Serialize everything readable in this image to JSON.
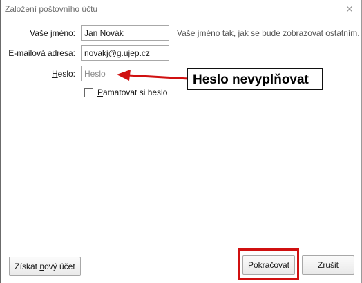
{
  "window": {
    "title": "Založení poštovního účtu",
    "close_glyph": "✕"
  },
  "form": {
    "name": {
      "label_pre": "",
      "label_u": "V",
      "label_post": "aše jméno:",
      "value": "Jan Novák",
      "hint": "Vaše jméno tak, jak se bude zobrazovat ostatním."
    },
    "email": {
      "label_pre": "E-mai",
      "label_u": "l",
      "label_post": "ová adresa:",
      "value": "novakj@g.ujep.cz"
    },
    "password": {
      "label_pre": "",
      "label_u": "H",
      "label_post": "eslo:",
      "placeholder": "Heslo"
    },
    "remember": {
      "label_pre": "",
      "label_u": "P",
      "label_post": "amatovat si heslo",
      "checked": false
    }
  },
  "annotation": {
    "text": "Heslo nevyplňovat",
    "arrow_color": "#d01010",
    "highlight_color": "#d01010"
  },
  "buttons": {
    "new_account": {
      "pre": "Získat ",
      "u": "n",
      "post": "ový účet"
    },
    "continue": {
      "pre": "",
      "u": "P",
      "post": "okračovat"
    },
    "cancel": {
      "pre": "",
      "u": "Z",
      "post": "rušit"
    }
  }
}
